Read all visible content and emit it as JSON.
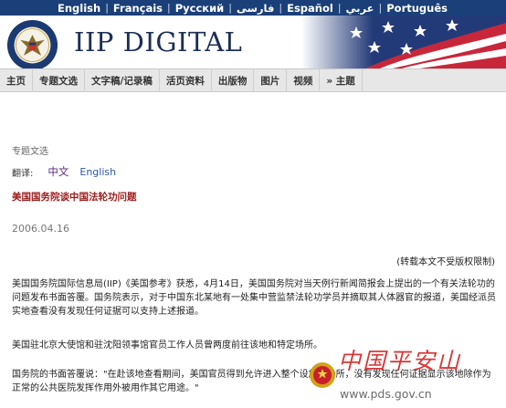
{
  "languages": [
    "English",
    "Français",
    "Русский",
    "فارسی",
    "Español",
    "عربي",
    "Português"
  ],
  "brand": {
    "logo_text": "IIP DIGITAL"
  },
  "nav": {
    "home": "主页",
    "topics": "专题文选",
    "transcripts": "文字稿/记录稿",
    "activities": "活页资料",
    "publications": "出版物",
    "images": "图片",
    "video": "视频",
    "more": "» 主题"
  },
  "article": {
    "section": "专题文选",
    "translation_label": "翻译:",
    "lang_zh": "中文",
    "lang_en": "English",
    "title": "美国国务院谈中国法轮功问题",
    "date": "2006.04.16",
    "copyright_note": "(转载本文不受版权限制)",
    "paragraphs": [
      "美国国务院国际信息局(IIP)《美国参考》获悉，4月14日，美国国务院对当天例行新闻简报会上提出的一个有关法轮功的问题发布书面答覆。国务院表示，对于中国东北某地有一处集中营监禁法轮功学员并摘取其人体器官的报道，美国经派员实地查看没有发现任何证据可以支持上述报道。",
      "美国驻北京大使馆和驻沈阳领事馆官员工作人员曾两度前往该地和特定场所。",
      "国务院的书面答覆说：\"在赴该地查看期间，美国官员得到允许进入整个设施和场所，没有发现任何证据显示该地除作为正常的公共医院发挥作用外被用作其它用途。\""
    ]
  },
  "watermark": {
    "text": "中国平安山",
    "url": "www.pds.gov.cn"
  },
  "colors": {
    "lang_bar": "#1b3f78",
    "logo_text": "#1c2f57",
    "nav_bg": "#e7e7e7",
    "title_red": "#9b1b1b",
    "translation_zh": "#5a2a83",
    "translation_en": "#2b5aa8"
  }
}
